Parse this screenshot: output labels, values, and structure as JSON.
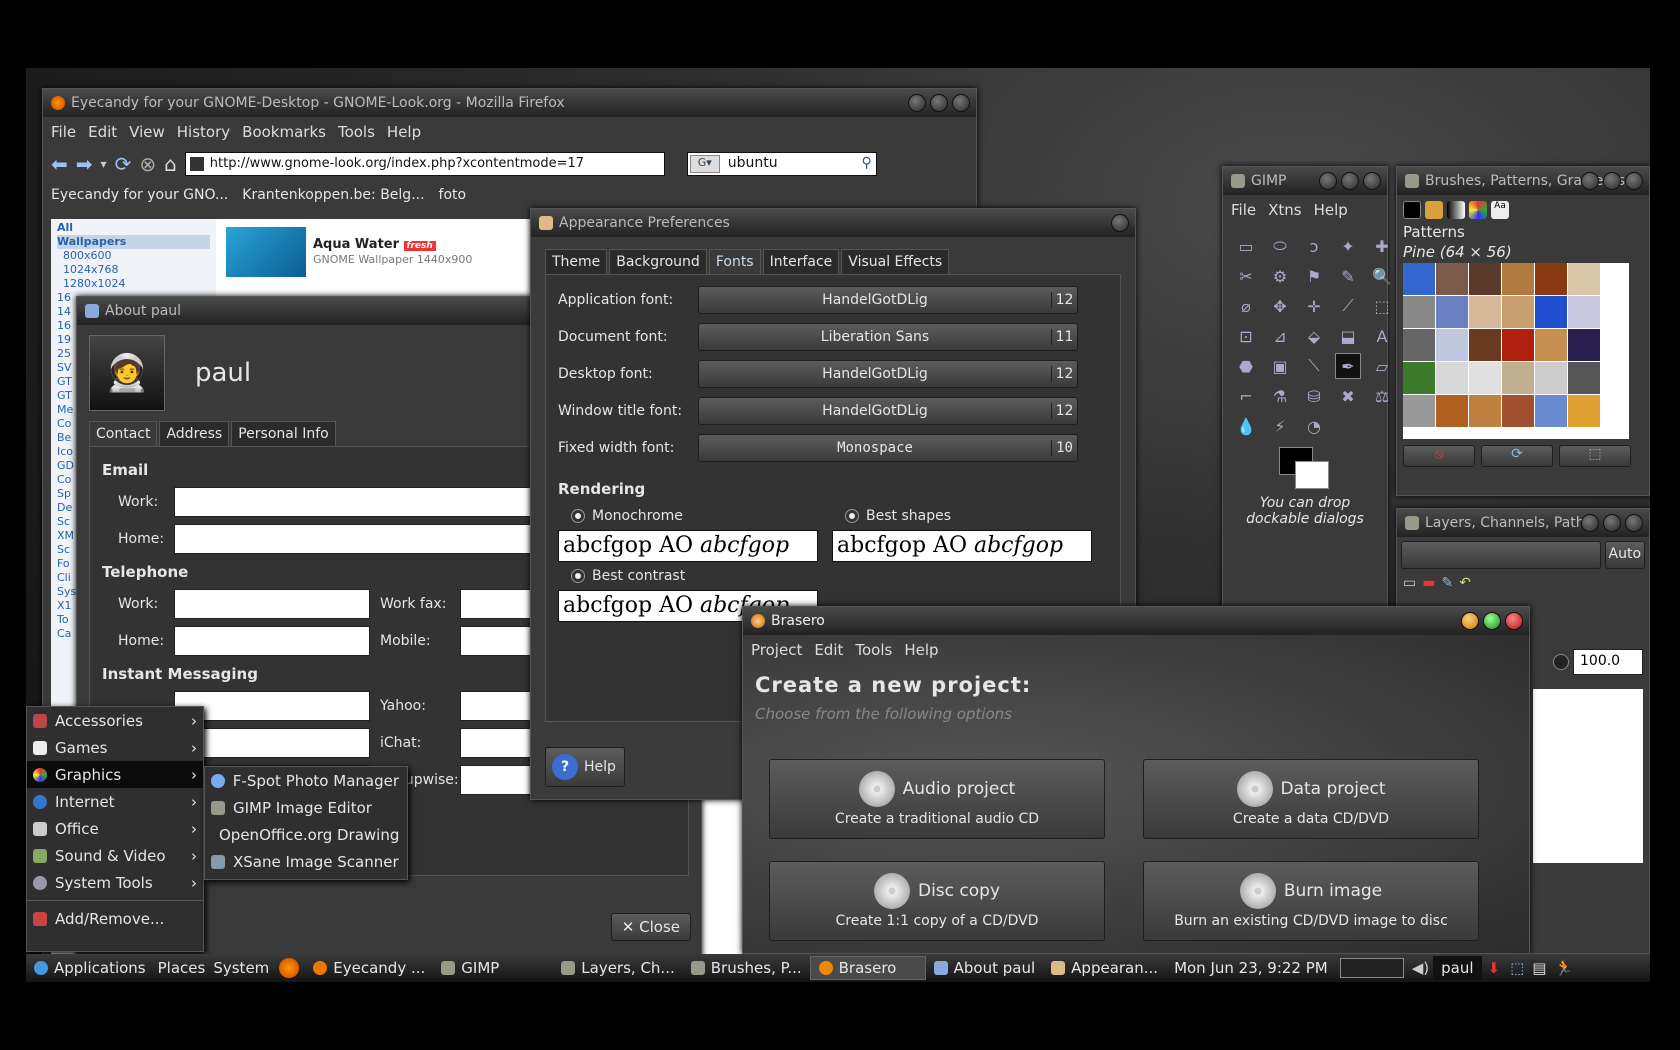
{
  "firefox": {
    "title": "Eyecandy for your GNOME-Desktop - GNOME-Look.org - Mozilla Firefox",
    "menu": [
      "File",
      "Edit",
      "View",
      "History",
      "Bookmarks",
      "Tools",
      "Help"
    ],
    "url": "http://www.gnome-look.org/index.php?xcontentmode=17",
    "search_value": "ubuntu",
    "bookmarks": [
      "Eyecandy for your GNO...",
      "Krantenkoppen.be: Belg...",
      "foto"
    ],
    "sidebar": [
      "All",
      "Wallpapers",
      "800x600",
      "1024x768",
      "1280x1024",
      "16",
      "14",
      "16",
      "19",
      "25",
      "SV",
      "GT",
      "GT",
      "Me",
      "Co",
      "Be",
      "Ico",
      "GD",
      "Co",
      "Sp",
      "De",
      "Sc",
      "XM",
      "Sc",
      "Fo",
      "Cli",
      "Sys",
      "X1",
      "To",
      "Ca"
    ],
    "item_title": "Aqua Water",
    "item_badge": "fresh",
    "item_sub": "GNOME Wallpaper 1440x900"
  },
  "about": {
    "title": "About paul",
    "user": "paul",
    "tabs": [
      "Contact",
      "Address",
      "Personal Info"
    ],
    "email_head": "Email",
    "work": "Work:",
    "home": "Home:",
    "tel_head": "Telephone",
    "work_fax": "Work fax:",
    "mobile": "Mobile:",
    "im_head": "Instant Messaging",
    "yahoo": "Yahoo:",
    "ichat": "iChat:",
    "groupwise": "Groupwise:",
    "close": "Close"
  },
  "appearance": {
    "title": "Appearance Preferences",
    "tabs": [
      "Theme",
      "Background",
      "Fonts",
      "Interface",
      "Visual Effects"
    ],
    "fonts": [
      {
        "label": "Application font:",
        "name": "HandelGotDLig",
        "size": "12"
      },
      {
        "label": "Document font:",
        "name": "Liberation Sans",
        "size": "11"
      },
      {
        "label": "Desktop font:",
        "name": "HandelGotDLig",
        "size": "12"
      },
      {
        "label": "Window title font:",
        "name": "HandelGotDLig",
        "size": "12"
      },
      {
        "label": "Fixed width font:",
        "name": "Monospace",
        "size": "10"
      }
    ],
    "rendering": "Rendering",
    "opt1": "Monochrome",
    "opt2": "Best shapes",
    "opt3": "Best contrast",
    "sample": "abcfgop AO ",
    "sample_i": "abcfgop",
    "help": "Help"
  },
  "gimp": {
    "title": "GIMP",
    "menu": [
      "File",
      "Xtns",
      "Help"
    ],
    "drop_text": "You can drop dockable dialogs"
  },
  "brushes": {
    "title": "Brushes, Patterns, Gradients",
    "section": "Patterns",
    "selected": "Pine (64 × 56)"
  },
  "layers": {
    "title": "Layers, Channels, Paths",
    "auto": "Auto",
    "opacity": "100.0"
  },
  "brasero": {
    "title": "Brasero",
    "menu": [
      "Project",
      "Edit",
      "Tools",
      "Help"
    ],
    "heading": "Create a new project:",
    "sub": "Choose from the following options",
    "buttons": [
      {
        "t": "Audio project",
        "d": "Create a traditional audio CD"
      },
      {
        "t": "Data project",
        "d": "Create a data CD/DVD"
      },
      {
        "t": "Disc copy",
        "d": "Create 1:1 copy of a CD/DVD"
      },
      {
        "t": "Burn image",
        "d": "Burn an existing CD/DVD image to disc"
      }
    ]
  },
  "appmenu": {
    "items": [
      "Accessories",
      "Games",
      "Graphics",
      "Internet",
      "Office",
      "Sound & Video",
      "System Tools"
    ],
    "add": "Add/Remove...",
    "graphics": [
      "F-Spot Photo Manager",
      "GIMP Image Editor",
      "OpenOffice.org Drawing",
      "XSane Image Scanner"
    ]
  },
  "panel": {
    "apps": "Applications",
    "places": "Places",
    "system": "System",
    "tasks": [
      "Eyecandy ...",
      "GIMP",
      "Layers, Ch...",
      "Brushes, P...",
      "Brasero",
      "About paul",
      "Appearan..."
    ],
    "clock": "Mon Jun 23,  9:22 PM",
    "user": "paul"
  }
}
